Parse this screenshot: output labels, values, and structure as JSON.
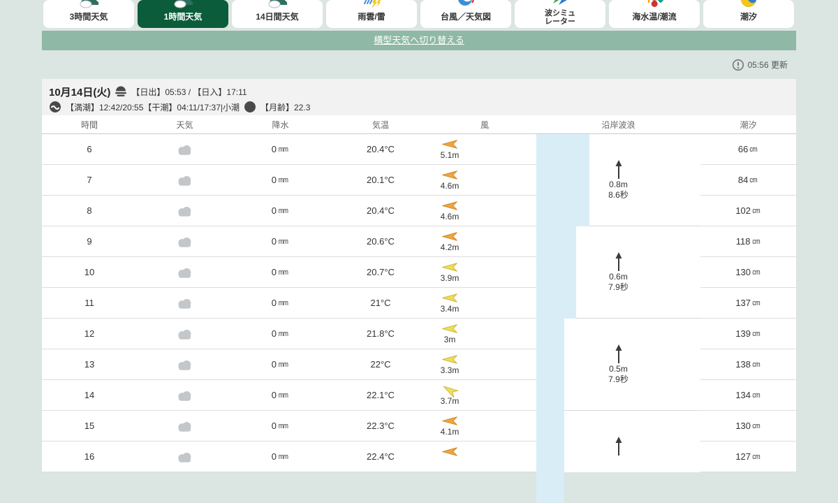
{
  "tabs": [
    {
      "label": "3時間天気"
    },
    {
      "label": "1時間天気"
    },
    {
      "label": "14日間天気"
    },
    {
      "label": "雨雲/雷"
    },
    {
      "label": "台風／天気図"
    },
    {
      "label": "波シミュ\nレーター"
    },
    {
      "label": "海水温/潮流"
    },
    {
      "label": "潮汐"
    }
  ],
  "switch_link": "横型天気へ切り替える",
  "updated": "05:56 更新",
  "date_header": {
    "date": "10月14日(火)",
    "sunrise_sunset": "【日出】05:53 / 【日入】17:11",
    "tide_text": "【満潮】12:42/20:55【干潮】04:11/17:37|小潮",
    "moon_text": "【月齢】22.3"
  },
  "table": {
    "columns": [
      "時間",
      "天気",
      "降水",
      "気温",
      "風",
      "沿岸波浪",
      "潮汐"
    ],
    "rows": [
      {
        "hour": "6",
        "weather": "cloudy",
        "precip": "0",
        "precip_unit": "mm",
        "temp": "20.4",
        "temp_unit": "°C",
        "wind_speed": "5.1m",
        "tide": "66",
        "tide_unit": "cm"
      },
      {
        "hour": "7",
        "weather": "cloudy",
        "precip": "0",
        "precip_unit": "mm",
        "temp": "20.1",
        "temp_unit": "°C",
        "wind_speed": "4.6m",
        "tide": "84",
        "tide_unit": "cm"
      },
      {
        "hour": "8",
        "weather": "cloudy",
        "precip": "0",
        "precip_unit": "mm",
        "temp": "20.4",
        "temp_unit": "°C",
        "wind_speed": "4.6m",
        "tide": "102",
        "tide_unit": "cm"
      },
      {
        "hour": "9",
        "weather": "cloudy",
        "precip": "0",
        "precip_unit": "mm",
        "temp": "20.6",
        "temp_unit": "°C",
        "wind_speed": "4.2m",
        "tide": "118",
        "tide_unit": "cm"
      },
      {
        "hour": "10",
        "weather": "cloudy",
        "precip": "0",
        "precip_unit": "mm",
        "temp": "20.7",
        "temp_unit": "°C",
        "wind_speed": "3.9m",
        "tide": "130",
        "tide_unit": "cm"
      },
      {
        "hour": "11",
        "weather": "cloudy",
        "precip": "0",
        "precip_unit": "mm",
        "temp": "21",
        "temp_unit": "°C",
        "wind_speed": "3.4m",
        "tide": "137",
        "tide_unit": "cm"
      },
      {
        "hour": "12",
        "weather": "cloudy",
        "precip": "0",
        "precip_unit": "mm",
        "temp": "21.8",
        "temp_unit": "°C",
        "wind_speed": "3m",
        "tide": "139",
        "tide_unit": "cm"
      },
      {
        "hour": "13",
        "weather": "cloudy",
        "precip": "0",
        "precip_unit": "mm",
        "temp": "22",
        "temp_unit": "°C",
        "wind_speed": "3.3m",
        "tide": "138",
        "tide_unit": "cm"
      },
      {
        "hour": "14",
        "weather": "cloudy",
        "precip": "0",
        "precip_unit": "mm",
        "temp": "22.1",
        "temp_unit": "°C",
        "wind_speed": "3.7m",
        "tide": "134",
        "tide_unit": "cm"
      },
      {
        "hour": "15",
        "weather": "cloudy",
        "precip": "0",
        "precip_unit": "mm",
        "temp": "22.3",
        "temp_unit": "°C",
        "wind_speed": "4.1m",
        "tide": "130",
        "tide_unit": "cm"
      },
      {
        "hour": "16",
        "weather": "cloudy",
        "precip": "0",
        "precip_unit": "mm",
        "temp": "22.4",
        "temp_unit": "°C",
        "wind_speed": "",
        "tide": "127",
        "tide_unit": "cm"
      }
    ],
    "wave_groups": [
      {
        "height": "0.8m",
        "period": "8.6秒"
      },
      {
        "height": "0.6m",
        "period": "7.9秒"
      },
      {
        "height": "0.5m",
        "period": "7.9秒"
      },
      {
        "height": "",
        "period": ""
      }
    ]
  },
  "colors": {
    "accent_green": "#0b5c3a",
    "bar_green": "#8fb8a6",
    "wave_blue": "#d9edf7",
    "wind_strong": "#f2a53e",
    "wind_weak": "#f2de54"
  }
}
